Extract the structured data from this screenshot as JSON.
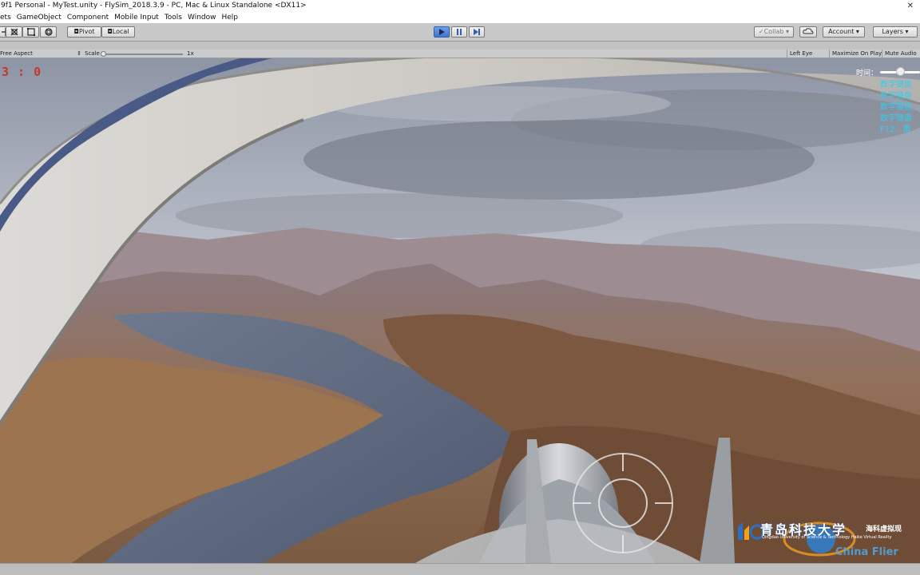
{
  "window": {
    "title": "9f1 Personal - MyTest.unity - FlySim_2018.3.9 - PC, Mac & Linux Standalone <DX11>",
    "close_glyph": "✕"
  },
  "menu": [
    "ets",
    "GameObject",
    "Component",
    "Mobile Input",
    "Tools",
    "Window",
    "Help"
  ],
  "toolbar": {
    "pivot_label": "Pivot",
    "local_label": "Local",
    "collab_label": "Collab",
    "account_label": "Account",
    "layers_label": "Layers"
  },
  "game_bar": {
    "aspect_label": "Free Aspect",
    "scale_label": "Scale",
    "scale_value": "1x",
    "scale_fraction": 0.0,
    "left_eye_label": "Left Eye",
    "maximize_label": "Maximize On Play",
    "mute_label": "Mute Audio"
  },
  "hud": {
    "score": "3 : 0",
    "time_label": "时间：",
    "time_fraction": 0.5,
    "hints": [
      "数字键盘",
      "数字键盘",
      "数字键盘",
      "数字键盘",
      "F12：重"
    ]
  },
  "logo": {
    "school": "青岛科技大学",
    "virtual": "海科虚拟现",
    "english": "Qingdao University of Science & Technology  Haike Virtual Reality",
    "watermark": "China Flier"
  },
  "colors": {
    "play_active": "#3f74cc",
    "score": "#c0392b",
    "hint": "#33ccee",
    "editor_bg": "#c2c2c2"
  }
}
